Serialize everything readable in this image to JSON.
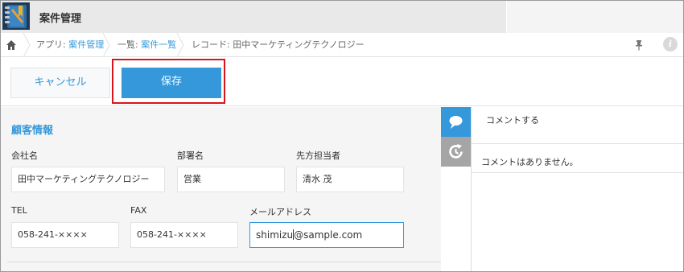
{
  "app": {
    "title": "案件管理"
  },
  "breadcrumb": {
    "app_prefix": "アプリ: ",
    "app_link": "案件管理",
    "list_prefix": "一覧: ",
    "list_link": "案件一覧",
    "record": "レコード: 田中マーケティングテクノロジー"
  },
  "toolbar": {
    "cancel_label": "キャンセル",
    "save_label": "保存"
  },
  "form": {
    "section_title": "顧客情報",
    "fields": {
      "company": {
        "label": "会社名",
        "value": "田中マーケティングテクノロジー"
      },
      "department": {
        "label": "部署名",
        "value": "営業"
      },
      "contact": {
        "label": "先方担当者",
        "value": "清水 茂"
      },
      "tel": {
        "label": "TEL",
        "value": "058-241-××××"
      },
      "fax": {
        "label": "FAX",
        "value": "058-241-××××"
      },
      "email": {
        "label": "メールアドレス",
        "value_before_cursor": "shimizu",
        "value_after_cursor": "@sample.com"
      }
    }
  },
  "comments": {
    "entry_label": "コメントする",
    "empty_text": "コメントはありません。"
  },
  "colors": {
    "accent": "#3498db",
    "highlight": "#d9141b",
    "header_bg": "#e9e9e9",
    "form_bg": "#f5f5f5"
  },
  "icons": [
    "app-notebook-icon",
    "home-icon",
    "pin-icon",
    "info-icon",
    "comment-bubble-icon",
    "history-icon"
  ]
}
